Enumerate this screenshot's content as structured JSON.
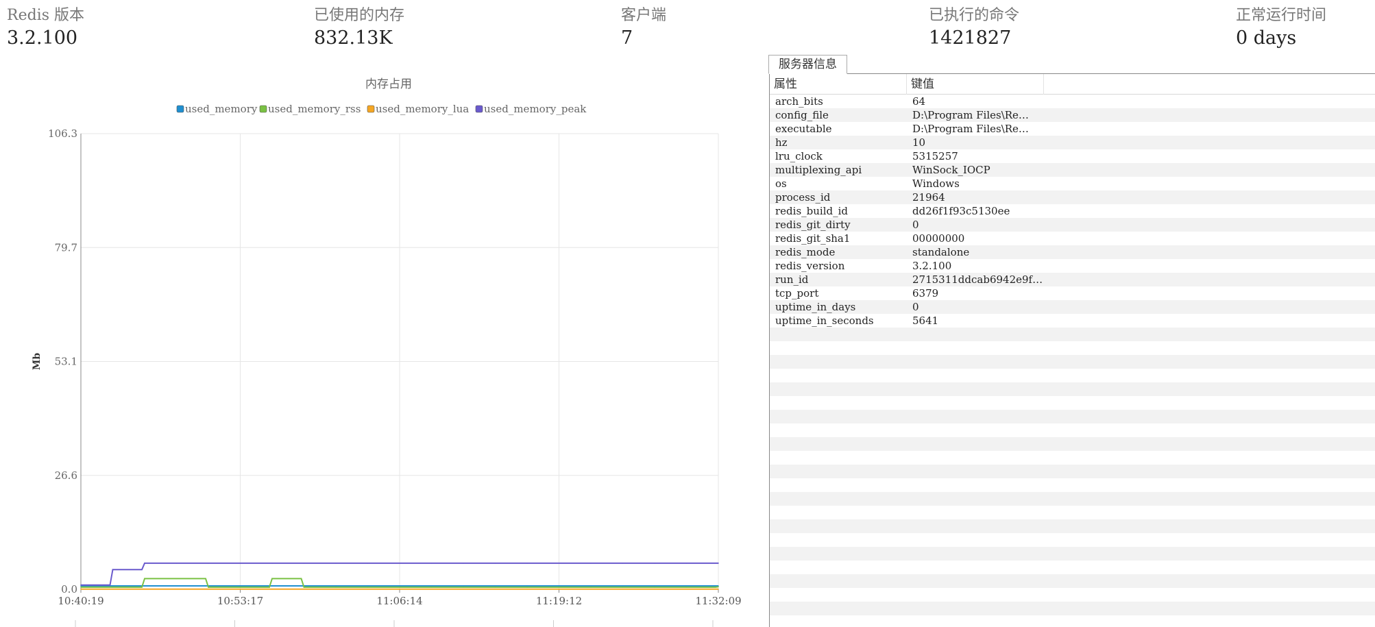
{
  "stats": [
    {
      "label": "Redis 版本",
      "value": "3.2.100"
    },
    {
      "label": "已使用的内存",
      "value": "832.13K"
    },
    {
      "label": "客户端",
      "value": "7"
    },
    {
      "label": "已执行的命令",
      "value": "1421827"
    },
    {
      "label": "正常运行时间",
      "value": "0 days"
    }
  ],
  "server_info": {
    "tab_label": "服务器信息",
    "columns": [
      "属性",
      "键值"
    ],
    "rows": [
      {
        "key": "arch_bits",
        "value": "64"
      },
      {
        "key": "config_file",
        "value": "D:\\Program Files\\Re…"
      },
      {
        "key": "executable",
        "value": "D:\\Program Files\\Re…"
      },
      {
        "key": "hz",
        "value": "10"
      },
      {
        "key": "lru_clock",
        "value": "5315257"
      },
      {
        "key": "multiplexing_api",
        "value": "WinSock_IOCP"
      },
      {
        "key": "os",
        "value": "Windows"
      },
      {
        "key": "process_id",
        "value": "21964"
      },
      {
        "key": "redis_build_id",
        "value": "dd26f1f93c5130ee"
      },
      {
        "key": "redis_git_dirty",
        "value": "0"
      },
      {
        "key": "redis_git_sha1",
        "value": "00000000"
      },
      {
        "key": "redis_mode",
        "value": "standalone"
      },
      {
        "key": "redis_version",
        "value": "3.2.100"
      },
      {
        "key": "run_id",
        "value": "2715311ddcab6942e9f…"
      },
      {
        "key": "tcp_port",
        "value": "6379"
      },
      {
        "key": "uptime_in_days",
        "value": "0"
      },
      {
        "key": "uptime_in_seconds",
        "value": "5641"
      }
    ]
  },
  "chart_data": {
    "type": "line",
    "title": "内存占用",
    "ylabel": "Mb",
    "xlabel": "",
    "ylim": [
      0,
      106.3
    ],
    "yticks": [
      "0.0",
      "26.6",
      "53.1",
      "79.7",
      "106.3"
    ],
    "xticks": [
      "10:40:19",
      "10:53:17",
      "11:06:14",
      "11:19:12",
      "11:32:09"
    ],
    "x": [
      0,
      1,
      2,
      3,
      4,
      5,
      6,
      7,
      8,
      9,
      10,
      11,
      12,
      13,
      14,
      15,
      16,
      17,
      18,
      19,
      20
    ],
    "legend_position": "top-center",
    "grid": true,
    "series": [
      {
        "name": "used_memory",
        "color": "#1f8fd0",
        "values": [
          0.8,
          0.8,
          0.8,
          0.8,
          0.8,
          0.8,
          0.8,
          0.8,
          0.8,
          0.8,
          0.8,
          0.8,
          0.8,
          0.8,
          0.8,
          0.8,
          0.8,
          0.8,
          0.8,
          0.8,
          0.8
        ]
      },
      {
        "name": "used_memory_rss",
        "color": "#7ac143",
        "values": [
          0.5,
          0.5,
          2.5,
          2.5,
          0.5,
          0.5,
          2.5,
          0.5,
          0.5,
          0.5,
          0.5,
          0.5,
          0.5,
          0.5,
          0.5,
          0.5,
          0.5,
          0.5,
          0.5,
          0.5,
          0.6
        ]
      },
      {
        "name": "used_memory_lua",
        "color": "#f5a623",
        "values": [
          0.04,
          0.04,
          0.04,
          0.04,
          0.04,
          0.04,
          0.04,
          0.04,
          0.04,
          0.04,
          0.04,
          0.04,
          0.04,
          0.04,
          0.04,
          0.04,
          0.04,
          0.04,
          0.04,
          0.04,
          0.04
        ]
      },
      {
        "name": "used_memory_peak",
        "color": "#6a5acd",
        "values": [
          1.0,
          4.6,
          6.1,
          6.1,
          6.1,
          6.1,
          6.1,
          6.1,
          6.1,
          6.1,
          6.1,
          6.1,
          6.1,
          6.1,
          6.1,
          6.1,
          6.1,
          6.1,
          6.1,
          6.1,
          6.1
        ]
      }
    ]
  }
}
